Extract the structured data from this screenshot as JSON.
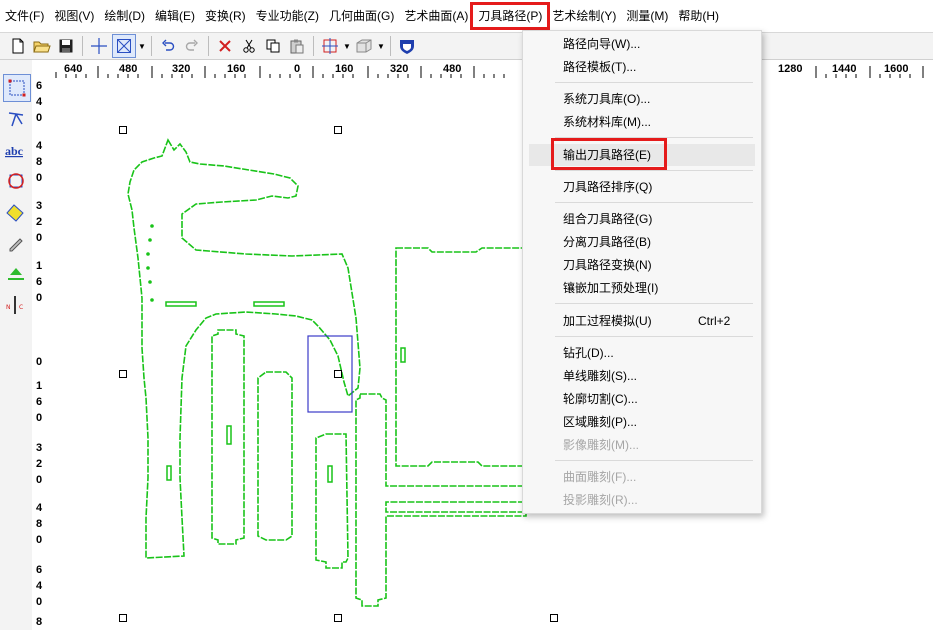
{
  "menubar": {
    "items": [
      {
        "label": "文件(F)"
      },
      {
        "label": "视图(V)"
      },
      {
        "label": "绘制(D)"
      },
      {
        "label": "编辑(E)"
      },
      {
        "label": "变换(R)"
      },
      {
        "label": "专业功能(Z)"
      },
      {
        "label": "几何曲面(G)"
      },
      {
        "label": "艺术曲面(A)"
      },
      {
        "label": "刀具路径(P)"
      },
      {
        "label": "艺术绘制(Y)"
      },
      {
        "label": "测量(M)"
      },
      {
        "label": "帮助(H)"
      }
    ],
    "active_index": 8
  },
  "toolbar": {
    "buttons": [
      "new-file-icon",
      "open-folder-icon",
      "save-icon",
      "crosshair-icon",
      "select-box-icon",
      "undo-icon",
      "redo-icon",
      "delete-icon",
      "cut-icon",
      "copy-icon",
      "paste-icon",
      "align-icon",
      "view-3d-icon",
      "shield-icon"
    ]
  },
  "palette": {
    "tools": [
      "node-edit-icon",
      "pick-icon",
      "text-icon",
      "circle-rect-icon",
      "diamond-icon",
      "pen-icon",
      "fill-icon",
      "measure-icon"
    ]
  },
  "hruler": {
    "labels": [
      "640",
      "480",
      "320",
      "160",
      "0",
      "160",
      "320",
      "480",
      "1280",
      "1440",
      "1600"
    ]
  },
  "vruler": {
    "labels": [
      "6",
      "4",
      "0",
      "4",
      "8",
      "0",
      "3",
      "2",
      "0",
      "1",
      "6",
      "0",
      "0",
      "1",
      "6",
      "0",
      "3",
      "2",
      "0",
      "4",
      "8",
      "0",
      "6",
      "4",
      "0",
      "8"
    ]
  },
  "dropdown": {
    "items": [
      {
        "label": "路径向导(W)...",
        "shortcut": "",
        "disabled": false
      },
      {
        "label": "路径模板(T)...",
        "shortcut": "",
        "disabled": false
      },
      {
        "label": "系统刀具库(O)...",
        "shortcut": "",
        "disabled": false
      },
      {
        "label": "系统材料库(M)...",
        "shortcut": "",
        "disabled": false
      },
      {
        "label": "输出刀具路径(E)",
        "shortcut": "",
        "disabled": false
      },
      {
        "label": "刀具路径排序(Q)",
        "shortcut": "",
        "disabled": false
      },
      {
        "label": "组合刀具路径(G)",
        "shortcut": "",
        "disabled": false
      },
      {
        "label": "分离刀具路径(B)",
        "shortcut": "",
        "disabled": false
      },
      {
        "label": "刀具路径变换(N)",
        "shortcut": "",
        "disabled": false
      },
      {
        "label": "镶嵌加工预处理(I)",
        "shortcut": "",
        "disabled": false
      },
      {
        "label": "加工过程模拟(U)",
        "shortcut": "Ctrl+2",
        "disabled": false
      },
      {
        "label": "钻孔(D)...",
        "shortcut": "",
        "disabled": false
      },
      {
        "label": "单线雕刻(S)...",
        "shortcut": "",
        "disabled": false
      },
      {
        "label": "轮廓切割(C)...",
        "shortcut": "",
        "disabled": false
      },
      {
        "label": "区域雕刻(P)...",
        "shortcut": "",
        "disabled": false
      },
      {
        "label": "影像雕刻(M)...",
        "shortcut": "",
        "disabled": true
      },
      {
        "label": "曲面雕刻(F)...",
        "shortcut": "",
        "disabled": true
      },
      {
        "label": "投影雕刻(R)...",
        "shortcut": "",
        "disabled": true
      }
    ],
    "highlighted_index": 4
  },
  "colors": {
    "accent_red": "#e51b1b",
    "path_green": "#19c319",
    "selection_blue": "#3b3bc8"
  }
}
